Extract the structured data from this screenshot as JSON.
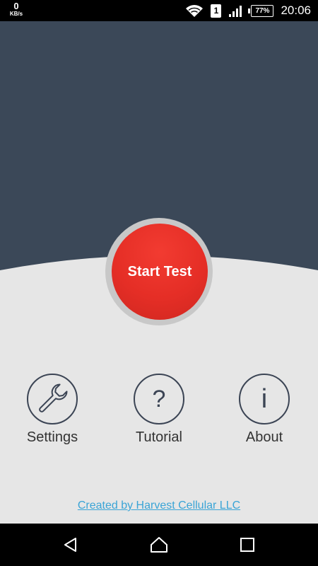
{
  "status_bar": {
    "net_speed_value": "0",
    "net_speed_unit": "KB/s",
    "sim_slot": "1",
    "battery_percent": "77%",
    "time": "20:06"
  },
  "main": {
    "start_button_label": "Start Test"
  },
  "menu": {
    "settings_label": "Settings",
    "tutorial_label": "Tutorial",
    "about_label": "About",
    "tutorial_glyph": "?",
    "about_glyph": "i"
  },
  "footer": {
    "credit_link": "Created by Harvest Cellular LLC"
  },
  "colors": {
    "header_bg": "#3b4858",
    "body_bg": "#e6e6e6",
    "start_button": "#e52e26",
    "icon_stroke": "#3b4454",
    "link": "#3aa4d6"
  },
  "icons": {
    "settings": "wrench-icon",
    "tutorial": "question-icon",
    "about": "info-icon",
    "nav_back": "back-triangle-icon",
    "nav_home": "home-icon",
    "nav_recents": "recents-square-icon"
  }
}
